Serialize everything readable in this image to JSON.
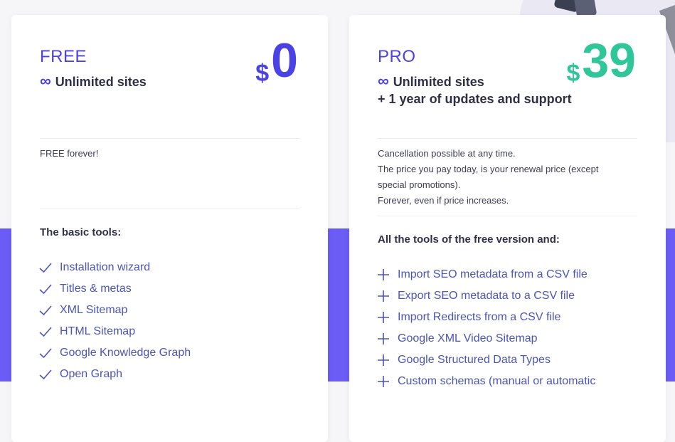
{
  "colors": {
    "accent": "#4b42e6",
    "pro_price": "#2fc79a",
    "band": "#6b5cf6",
    "feature_text": "#4b55b8"
  },
  "free": {
    "name": "FREE",
    "infinity": "∞",
    "sites": "Unlimited sites",
    "currency": "$",
    "price": "0",
    "note_lines": [
      "FREE forever!"
    ],
    "section_title": "The basic tools:",
    "feature_icon": "check-icon",
    "features": [
      "Installation wizard",
      "Titles & metas",
      "XML Sitemap",
      "HTML Sitemap",
      "Google Knowledge Graph",
      "Open Graph"
    ]
  },
  "pro": {
    "name": "PRO",
    "infinity": "∞",
    "sites": "Unlimited sites",
    "extra": "+ 1 year of updates and support",
    "currency": "$",
    "price": "39",
    "note_lines": [
      "Cancellation possible at any time.",
      "The price you pay today, is your renewal price (except",
      "special promotions).",
      "Forever, even if price increases."
    ],
    "section_title": "All the tools of the free version and:",
    "feature_icon": "plus-icon",
    "features": [
      "Import SEO metadata from a CSV file",
      "Export SEO metadata to a CSV file",
      "Import Redirects from a CSV file",
      "Google XML Video Sitemap",
      "Google Structured Data Types",
      "Custom schemas (manual or automatic"
    ]
  }
}
